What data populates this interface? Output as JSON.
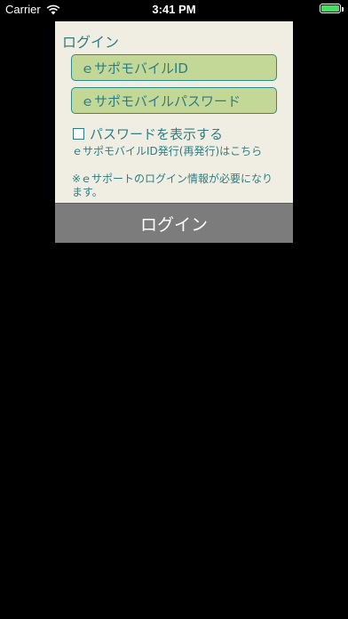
{
  "status_bar": {
    "carrier": "Carrier",
    "time": "3:41 PM",
    "battery_color": "#4cd964",
    "wifi_icon": "wifi-icon",
    "battery_level": 1.0
  },
  "login": {
    "title": "ログイン",
    "id_placeholder": "ｅサポモバイルID",
    "password_placeholder": "ｅサポモバイルパスワード",
    "show_password_label": "パスワードを表示する",
    "show_password_checked": false,
    "issue_link": "ｅサポモバイルID発行(再発行)はこちら",
    "note": "※ｅサポートのログイン情報が必要になります。",
    "button_label": "ログイン"
  },
  "colors": {
    "panel_bg": "#f0eee3",
    "field_bg": "#c3d897",
    "accent_text": "#2f7d83",
    "button_bg": "#7c7c7c",
    "screen_bg": "#000000"
  }
}
